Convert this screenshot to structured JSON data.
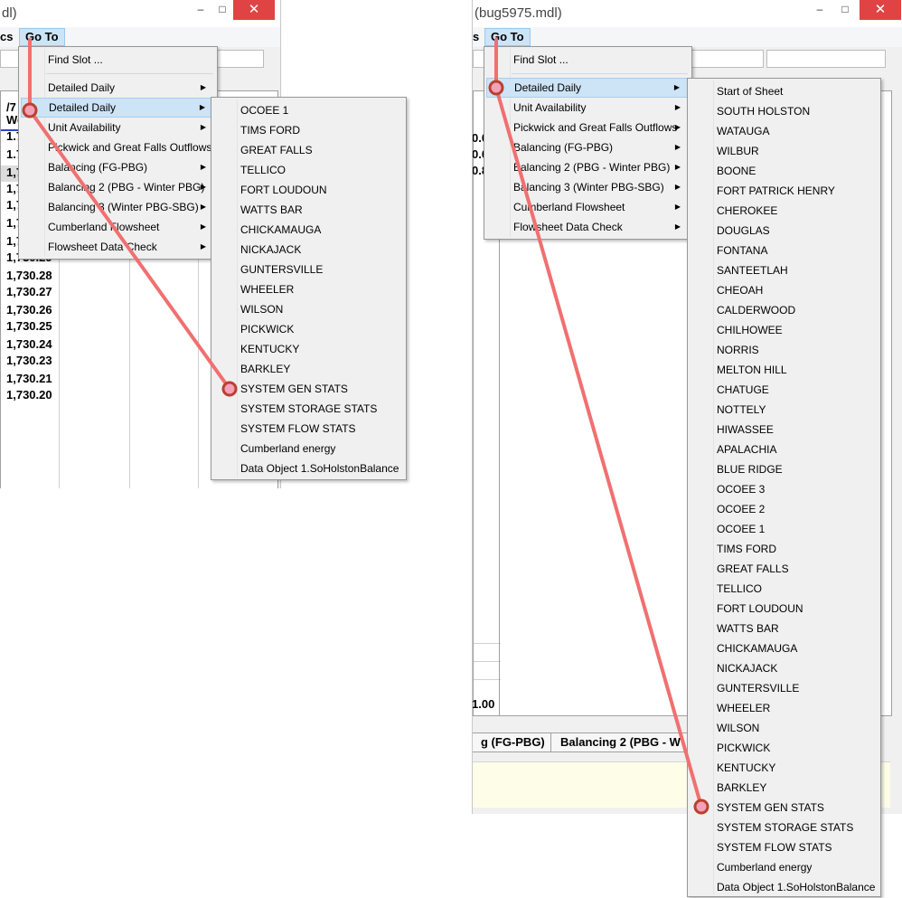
{
  "left": {
    "title": "dl)",
    "window_controls": {
      "minimize": "–",
      "maximize": "□",
      "close": "✕"
    },
    "menubar": {
      "prev_menu": "cs",
      "goto": "Go To"
    },
    "header": {
      "line1": "/7",
      "line2": "Wed"
    },
    "numbers": [
      "1.7",
      "1.7",
      "1,730.33",
      "1,730.33",
      "1,730.32",
      "1,730.31",
      "1,730.30",
      "1,730.29",
      "1,730.28",
      "1,730.27",
      "1,730.26",
      "1,730.25",
      "1,730.24",
      "1,730.23",
      "1,730.21",
      "1,730.20"
    ],
    "main_menu": [
      {
        "label": "Find Slot ...",
        "submenu": false
      },
      {
        "label": "Detailed Daily",
        "submenu": true
      },
      {
        "label": "Detailed Daily",
        "submenu": true,
        "highlighted": true
      },
      {
        "label": "Unit Availability",
        "submenu": true
      },
      {
        "label": "Pickwick and Great Falls Outflows",
        "submenu": false
      },
      {
        "label": "Balancing (FG-PBG)",
        "submenu": true
      },
      {
        "label": "Balancing 2 (PBG - Winter PBG)",
        "submenu": true
      },
      {
        "label": "Balancing 3 (Winter PBG-SBG)",
        "submenu": true
      },
      {
        "label": "Cumberland Flowsheet",
        "submenu": true
      },
      {
        "label": "Flowsheet Data Check",
        "submenu": true
      }
    ],
    "sub_menu": [
      "OCOEE 1",
      "TIMS FORD",
      "GREAT FALLS",
      "TELLICO",
      "FORT LOUDOUN",
      "WATTS BAR",
      "CHICKAMAUGA",
      "NICKAJACK",
      "GUNTERSVILLE",
      "WHEELER",
      "WILSON",
      "PICKWICK",
      "KENTUCKY",
      "BARKLEY",
      "SYSTEM GEN STATS",
      "SYSTEM STORAGE STATS",
      "SYSTEM FLOW STATS",
      "Cumberland energy",
      "Data Object 1.SoHolstonBalance"
    ]
  },
  "right": {
    "title": "(bug5975.mdl)",
    "window_controls": {
      "minimize": "–",
      "maximize": "□",
      "close": "✕"
    },
    "menubar": {
      "prev_menu": "s",
      "goto": "Go To"
    },
    "edge_values": [
      "0.0",
      "0.0",
      "0.8"
    ],
    "bottom_value": "1.00",
    "tabs": [
      "g (FG-PBG)",
      "Balancing 2 (PBG - W"
    ],
    "main_menu": [
      {
        "label": "Find Slot ...",
        "submenu": false
      },
      {
        "label": "Detailed Daily",
        "submenu": true,
        "highlighted": true
      },
      {
        "label": "Unit Availability",
        "submenu": true
      },
      {
        "label": "Pickwick and Great Falls Outflows",
        "submenu": true
      },
      {
        "label": "Balancing (FG-PBG)",
        "submenu": true
      },
      {
        "label": "Balancing 2 (PBG - Winter PBG)",
        "submenu": true
      },
      {
        "label": "Balancing 3 (Winter PBG-SBG)",
        "submenu": true
      },
      {
        "label": "Cumberland Flowsheet",
        "submenu": true
      },
      {
        "label": "Flowsheet Data Check",
        "submenu": true
      }
    ],
    "sub_menu": [
      "Start of Sheet",
      "SOUTH HOLSTON",
      "WATAUGA",
      "WILBUR",
      "BOONE",
      "FORT PATRICK HENRY",
      "CHEROKEE",
      "DOUGLAS",
      "FONTANA",
      "SANTEETLAH",
      "CHEOAH",
      "CALDERWOOD",
      "CHILHOWEE",
      "NORRIS",
      "MELTON HILL",
      "CHATUGE",
      "NOTTELY",
      "HIWASSEE",
      "APALACHIA",
      "BLUE RIDGE",
      "OCOEE 3",
      "OCOEE 2",
      "OCOEE 1",
      "TIMS FORD",
      "GREAT FALLS",
      "TELLICO",
      "FORT LOUDOUN",
      "WATTS BAR",
      "CHICKAMAUGA",
      "NICKAJACK",
      "GUNTERSVILLE",
      "WHEELER",
      "WILSON",
      "PICKWICK",
      "KENTUCKY",
      "BARKLEY",
      "SYSTEM GEN STATS",
      "SYSTEM STORAGE STATS",
      "SYSTEM FLOW STATS",
      "Cumberland energy",
      "Data Object 1.SoHolstonBalance"
    ]
  },
  "colors": {
    "annotation": "#f07070",
    "highlight": "#cde3f6",
    "close_button": "#e04343"
  }
}
